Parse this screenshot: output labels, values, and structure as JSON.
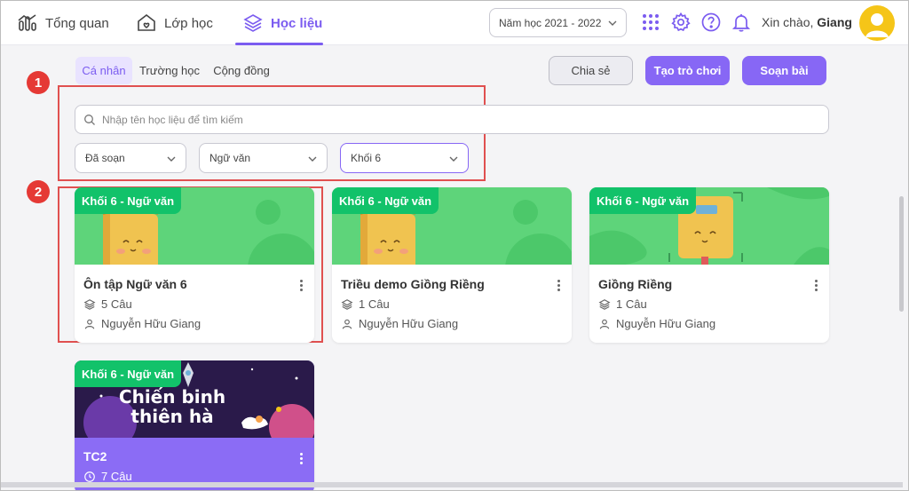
{
  "nav": {
    "items": [
      {
        "label": "Tổng quan",
        "icon": "chart-icon"
      },
      {
        "label": "Lớp học",
        "icon": "heart-house-icon"
      },
      {
        "label": "Học liệu",
        "icon": "layers-icon",
        "active": true
      }
    ],
    "year_select": "Năm học 2021 - 2022",
    "greeting_prefix": "Xin chào, ",
    "greeting_name": "Giang",
    "accent_color": "#7b5cf0"
  },
  "subtabs": [
    "Cá nhân",
    "Trường học",
    "Cộng đồng"
  ],
  "actions": {
    "share": "Chia sẻ",
    "create_game": "Tạo trò chơi",
    "compose": "Soạn bài"
  },
  "search": {
    "placeholder": "Nhập tên học liệu để tìm kiếm"
  },
  "filters": [
    "Đã soạn",
    "Ngữ văn",
    "Khối 6"
  ],
  "annotations": [
    "1",
    "2"
  ],
  "cards": [
    {
      "tag": "Khối 6 - Ngữ văn",
      "title": "Ôn tập Ngữ văn 6",
      "count": "5 Câu",
      "author": "Nguyễn Hữu Giang"
    },
    {
      "tag": "Khối 6 - Ngữ văn",
      "title": "Triều demo Giồng Riềng",
      "count": "1 Câu",
      "author": "Nguyễn Hữu Giang"
    },
    {
      "tag": "Khối 6 - Ngữ văn",
      "title": "Giồng Riềng",
      "count": "1 Câu",
      "author": "Nguyễn Hữu Giang"
    },
    {
      "tag": "Khối 6 - Ngữ văn",
      "title": "TC2",
      "count": "7 Câu",
      "banner_text_1": "Chiến binh",
      "banner_text_2": "thiên hà"
    }
  ],
  "colors": {
    "tag_green": "#12c26a",
    "banner_green": "#5ed47a",
    "purple": "#8767f5",
    "annotation_red": "#e53935"
  }
}
